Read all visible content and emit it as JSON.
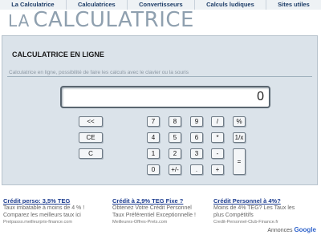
{
  "nav": {
    "items": [
      "La Calculatrice",
      "Calculatrices",
      "Convertisseurs",
      "Calculs ludiques",
      "Sites utiles"
    ]
  },
  "logo": {
    "la": "LA",
    "calc": "CALCULATRICE"
  },
  "calculator": {
    "title": "CALCULATRICE EN LIGNE",
    "description": "Calculatrice en ligne, possibilité de faire les calculs avec le clavier ou la souris",
    "display_value": "0",
    "keys": {
      "backspace": "<<",
      "clear_entry": "CE",
      "clear": "C",
      "d7": "7",
      "d8": "8",
      "d9": "9",
      "d4": "4",
      "d5": "5",
      "d6": "6",
      "d1": "1",
      "d2": "2",
      "d3": "3",
      "d0": "0",
      "sign": "+/-",
      "dot": ".",
      "divide": "/",
      "percent": "%",
      "multiply": "*",
      "reciprocal": "1/x",
      "minus": "-",
      "plus": "+",
      "equals": "="
    }
  },
  "ads": [
    {
      "title": "Crédit perso: 3,5% TEG",
      "lines": [
        "Taux imbatable à moins de 4 % !",
        "Comparez les meilleurs taux ici"
      ],
      "url": "Pretpasso.meilleurprix-finance.com"
    },
    {
      "title": "Crédit à 2,9% TEG Fixe ?",
      "lines": [
        "Obtenez Votre Crédit Personnel",
        "Taux Préférentiel Exceptionnelle !"
      ],
      "url": "Meilleures-Offres-Prets.com"
    },
    {
      "title": "Crédit Personnel à 4%?",
      "lines": [
        "Moins de 4% TEG? Les Taux les",
        "plus Compétitifs"
      ],
      "url": "Credit-Personnel-Club-Finance.fr"
    }
  ],
  "ads_label": {
    "prefix": "Annonces",
    "brand": "Google"
  }
}
